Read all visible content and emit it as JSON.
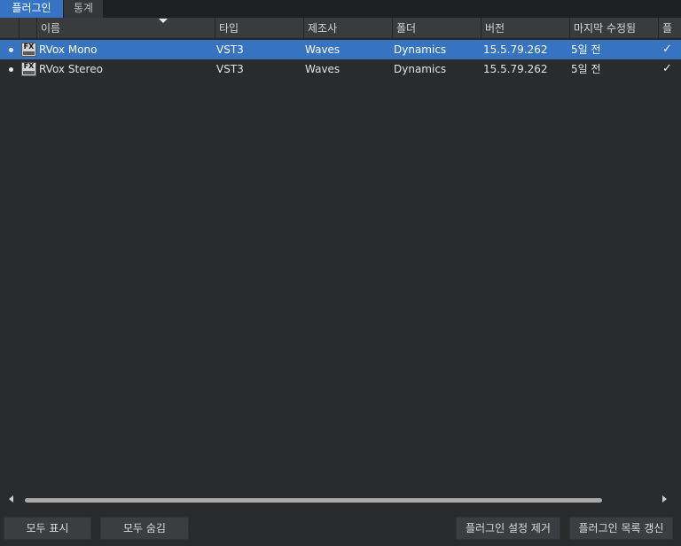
{
  "tabs": [
    {
      "label": "플러그인",
      "active": true
    },
    {
      "label": "통계",
      "active": false
    }
  ],
  "columns": [
    "이름",
    "타입",
    "제조사",
    "폴더",
    "버전",
    "마지막 수정됨",
    "플"
  ],
  "rows": [
    {
      "name": "RVox Mono",
      "type": "VST3",
      "vendor": "Waves",
      "folder": "Dynamics",
      "version": "15.5.79.262",
      "modified": "5일 전",
      "selected": true,
      "checked": true,
      "icon": "fx-plugin-icon"
    },
    {
      "name": "RVox Stereo",
      "type": "VST3",
      "vendor": "Waves",
      "folder": "Dynamics",
      "version": "15.5.79.262",
      "modified": "5일 전",
      "selected": false,
      "checked": true,
      "icon": "fx-plugin-icon"
    }
  ],
  "fx_icon_text": "FX",
  "check_glyph": "✓",
  "buttons": {
    "show_all": "모두 표시",
    "hide_all": "모두 숨김",
    "remove_settings": "플러그인 설정 제거",
    "refresh_list": "플러그인 목록 갱신"
  },
  "colors": {
    "background": "#2a2b2d",
    "header": "#3a3b3e",
    "selection": "#3673c0",
    "active_tab": "#3574c4"
  }
}
